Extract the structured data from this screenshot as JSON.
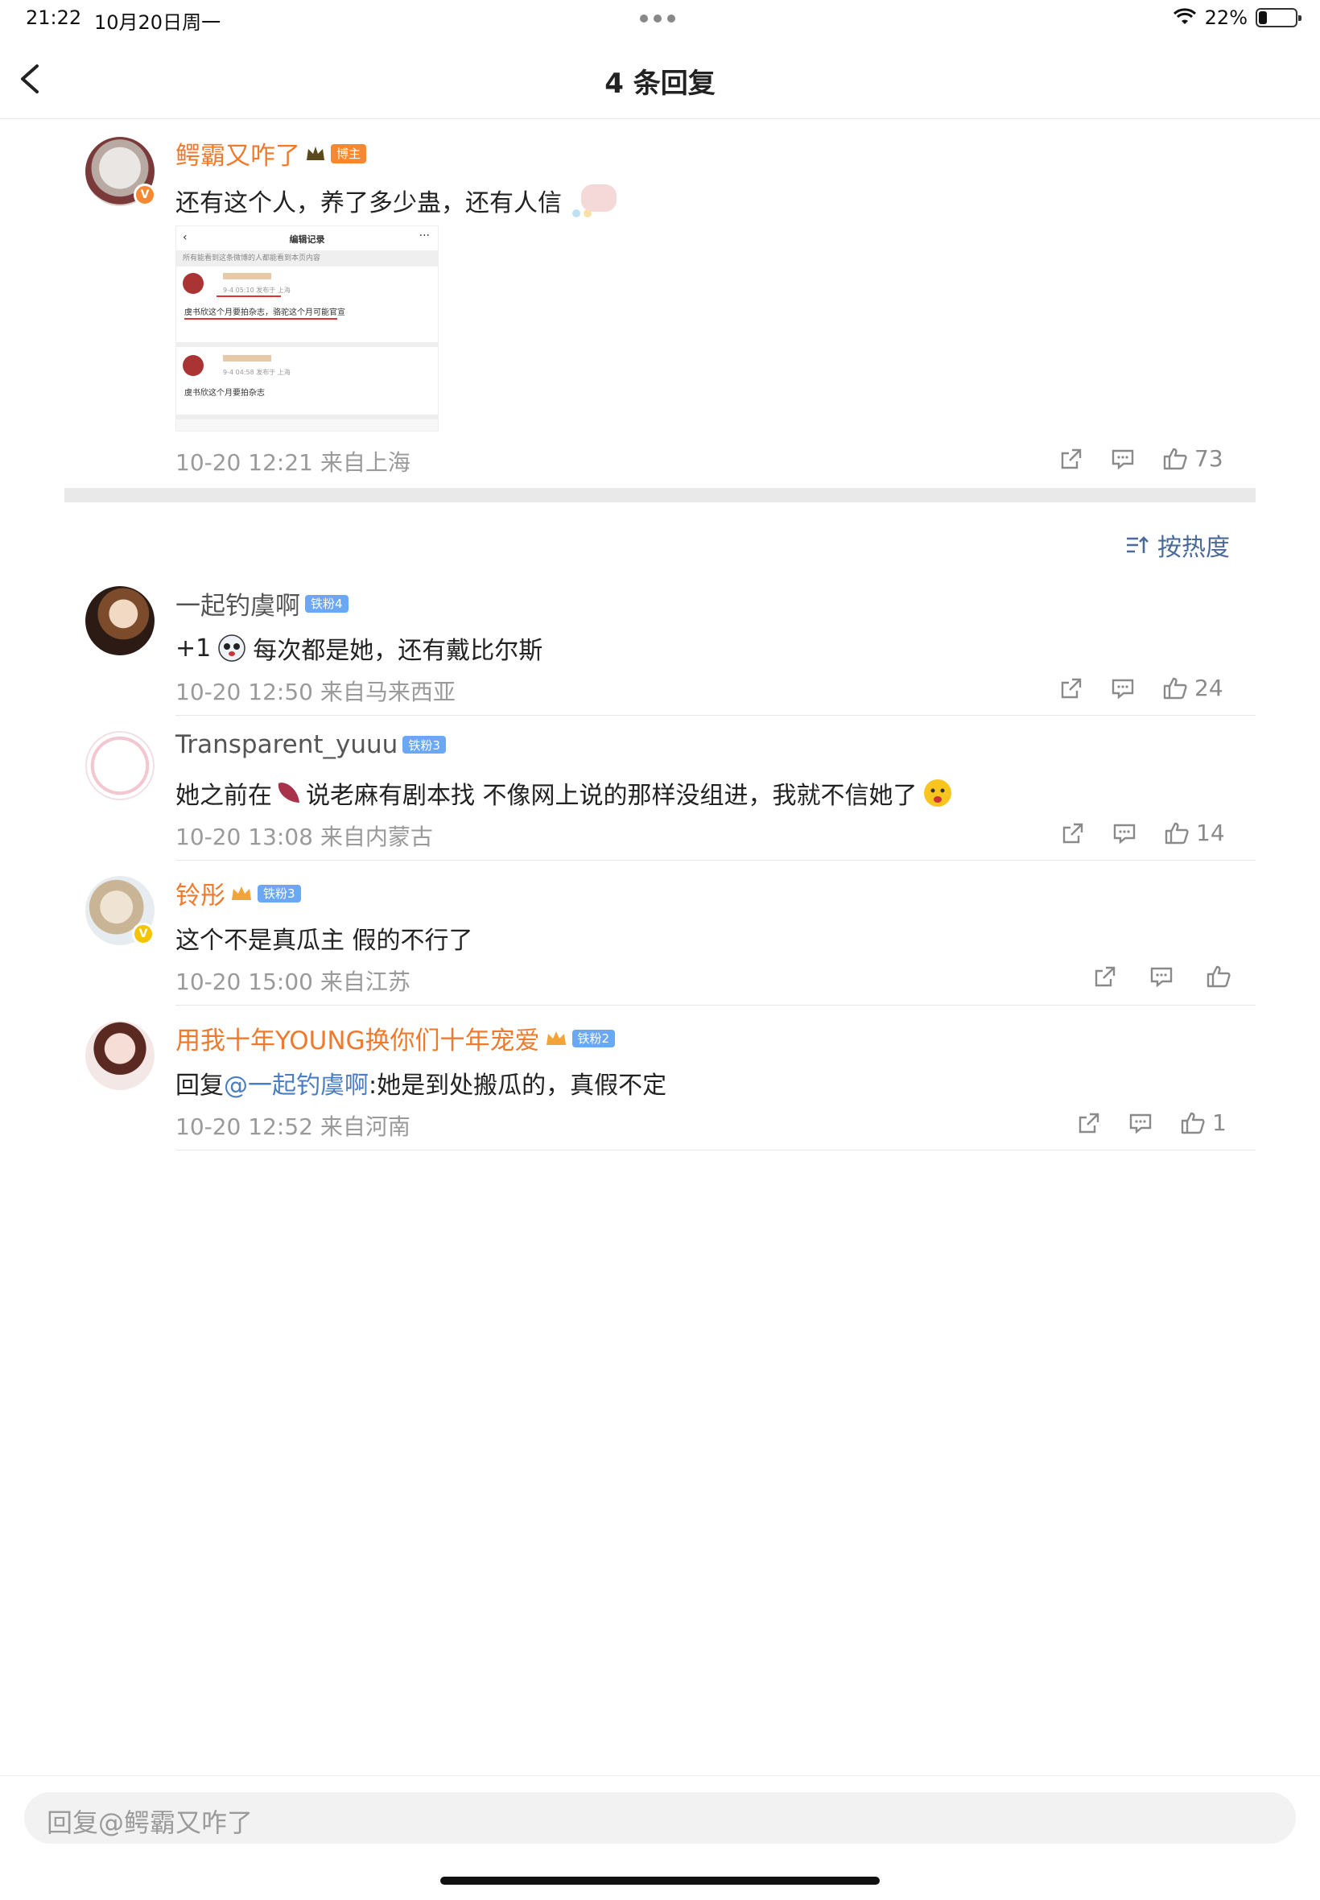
{
  "status_bar": {
    "time": "21:22",
    "date": "10月20日周一",
    "battery": "22%",
    "battery_level": 0.22
  },
  "nav": {
    "title": "4 条回复"
  },
  "main_comment": {
    "username": "鳄霸又咋了",
    "badge": "博主",
    "text": "还有这个人，养了多少蛊，还有人信",
    "meta": "10-20 12:21 来自上海",
    "likes": "73",
    "embed": {
      "header": "编辑记录",
      "subtitle": "所有能看到这条微博的人都能看到本页内容",
      "rows": [
        {
          "time": "9-4 05:10  发布于 上海",
          "text": "虞书欣这个月要拍杂志，骆驼这个月可能官宣"
        },
        {
          "time": "9-4 04:58  发布于 上海",
          "text": "虞书欣这个月要拍杂志"
        }
      ]
    }
  },
  "sort": {
    "label": "按热度"
  },
  "replies": [
    {
      "username": "一起钓虞啊",
      "badge": "铁粉4",
      "text_prefix": "+1",
      "text": "每次都是她，还有戴比尔斯",
      "meta": "10-20 12:50 来自马来西亚",
      "likes": "24"
    },
    {
      "username": "Transparent_yuuu",
      "badge": "铁粉3",
      "text_prefix": "她之前在",
      "text": "说老麻有剧本找 不像网上说的那样没组进，我就不信她了",
      "meta": "10-20 13:08 来自内蒙古",
      "likes": "14"
    },
    {
      "username": "铃彤",
      "badge": "铁粉3",
      "text": "这个不是真瓜主 假的不行了",
      "meta": "10-20 15:00 来自江苏",
      "likes": ""
    },
    {
      "username": "用我十年YOUNG换你们十年宠爱",
      "badge": "铁粉2",
      "reply_label": "回复",
      "mention": "@一起钓虞啊",
      "text": ":她是到处搬瓜的，真假不定",
      "meta": "10-20 12:52 来自河南",
      "likes": "1"
    }
  ],
  "reply_input": {
    "placeholder": "回复@鳄霸又咋了"
  },
  "colors": {
    "accent": "#ee7a2e",
    "fan_badge": "#6aa7f5",
    "link": "#4a7ec2"
  }
}
